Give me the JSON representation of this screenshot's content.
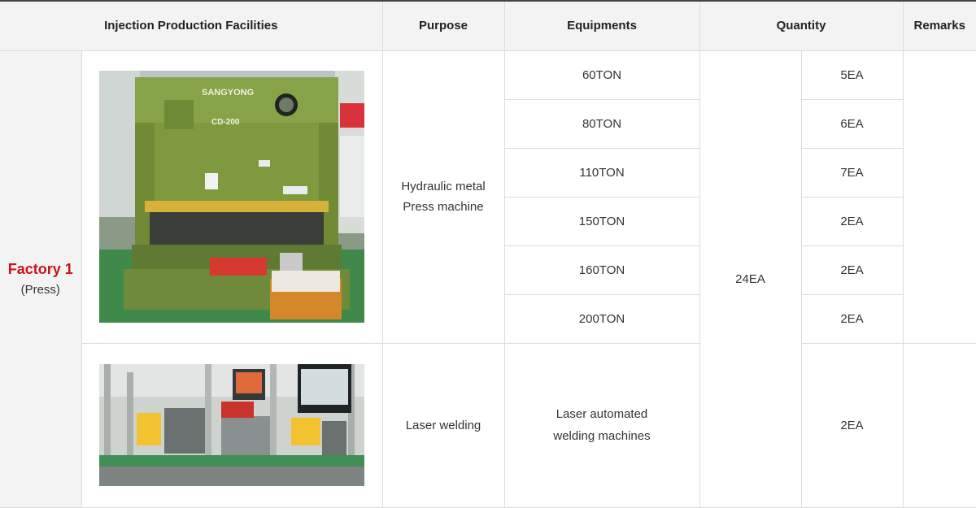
{
  "header": {
    "facilities": "Injection Production Facilities",
    "purpose": "Purpose",
    "equipments": "Equipments",
    "quantity": "Quantity",
    "remarks": "Remarks"
  },
  "factory": {
    "name": "Factory 1",
    "sub": "(Press)"
  },
  "press": {
    "photo_text": {
      "brand": "SANGYONG",
      "model": "CD-200"
    },
    "purpose_line1": "Hydraulic metal",
    "purpose_line2": "Press machine",
    "rows": [
      {
        "equipment": "60TON",
        "quantity": "5EA"
      },
      {
        "equipment": "80TON",
        "quantity": "6EA"
      },
      {
        "equipment": "110TON",
        "quantity": "7EA"
      },
      {
        "equipment": "150TON",
        "quantity": "2EA"
      },
      {
        "equipment": "160TON",
        "quantity": "2EA"
      },
      {
        "equipment": "200TON",
        "quantity": "2EA"
      }
    ]
  },
  "total_quantity": "24EA",
  "weld": {
    "purpose": "Laser welding",
    "equipment_line1": "Laser automated",
    "equipment_line2": "welding machines",
    "quantity": "2EA"
  },
  "colors": {
    "accent": "#c8131b",
    "header_bg": "#f3f3f3",
    "border": "#dcdcdc",
    "machine_green": "#7f9a3e"
  }
}
